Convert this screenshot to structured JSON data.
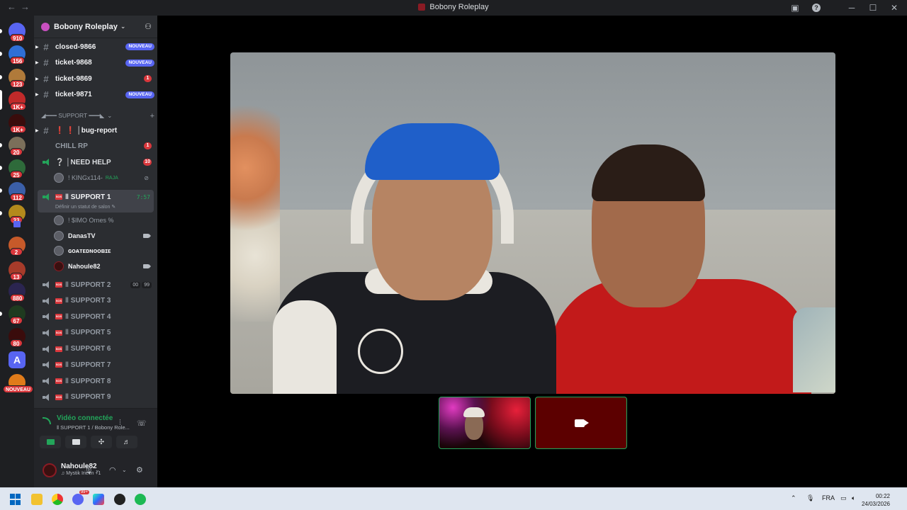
{
  "window": {
    "title": "Bobony Roleplay",
    "nav_back": "←",
    "nav_forward": "→"
  },
  "rail": {
    "servers": [
      {
        "badge": "910",
        "color": "#5865f2"
      },
      {
        "badge": "156",
        "color": "#2f6fd6"
      },
      {
        "badge": "123",
        "color": "#b07a3a"
      },
      {
        "badge": "1K+",
        "color": "#c02a2a"
      },
      {
        "badge": "1K+",
        "color": "#3a0c0c"
      },
      {
        "badge": "20",
        "color": "#7b6f5a"
      },
      {
        "badge": "25",
        "color": "#2e6a3a"
      },
      {
        "badge": "112",
        "color": "#3b5fa8"
      },
      {
        "badge": "33",
        "color": "#b48a1c"
      },
      {
        "badge": "2",
        "color": "#c75a2a"
      },
      {
        "badge": "13",
        "color": "#a63b2a"
      },
      {
        "badge": "880",
        "color": "#2b2550"
      },
      {
        "badge": "67",
        "color": "#1f3a1f"
      },
      {
        "badge": "80",
        "color": "#3a0c0c"
      },
      {
        "badge": "",
        "color": "#5865f2",
        "glyph": "A"
      },
      {
        "badge": "NOUVEAU",
        "color": "#e07b1a"
      }
    ]
  },
  "guild": {
    "name": "Bobony Roleplay"
  },
  "channels": {
    "tickets": [
      {
        "name": "closed-9866",
        "badge": "NOUVEAU"
      },
      {
        "name": "ticket-9868",
        "badge": "NOUVEAU"
      },
      {
        "name": "ticket-9869",
        "badge": "1"
      },
      {
        "name": "ticket-9871",
        "badge": "NOUVEAU"
      }
    ],
    "category": "◢━━━ SUPPORT ━━━◣",
    "bug_report": "❗ ❗ │bug-report",
    "chill": {
      "name": "CHILL RP",
      "badge": "1"
    },
    "need_help": {
      "name": "❔ │NEED HELP",
      "badge": "10"
    },
    "need_help_member": "! KINGx114-",
    "need_help_tag": "RAJA",
    "support1": {
      "name": "‖ SUPPORT 1",
      "timer": "7:57",
      "status": "Définir un statut de salon ✎"
    },
    "support1_members": [
      {
        "name": "! $IMO Ornes %",
        "cam": false,
        "dim": true
      },
      {
        "name": "DanasTV",
        "cam": true,
        "dim": false
      },
      {
        "name": "ɢᴏᴀᴛᴇᴅɴᴏᴏʙɪᴇ",
        "cam": false,
        "dim": false
      },
      {
        "name": "Nahoule82",
        "cam": true,
        "dim": false
      }
    ],
    "support2": {
      "name": "‖ SUPPORT 2",
      "count_a": "00",
      "count_b": "99"
    },
    "support_rest": [
      "‖ SUPPORT 3",
      "‖ SUPPORT 4",
      "‖ SUPPORT 5",
      "‖ SUPPORT 6",
      "‖ SUPPORT 7",
      "‖ SUPPORT 8",
      "‖ SUPPORT 9"
    ]
  },
  "voice": {
    "status": "Vidéo connectée",
    "location": "‖ SUPPORT 1 / Bobony Role..."
  },
  "user": {
    "name": "Nahoule82",
    "activity": "♫ Mystik Irieen +1"
  },
  "taskbar": {
    "lang": "FRA",
    "time": "00:22",
    "date": "24/03/2026",
    "discord_badge": "99+"
  }
}
